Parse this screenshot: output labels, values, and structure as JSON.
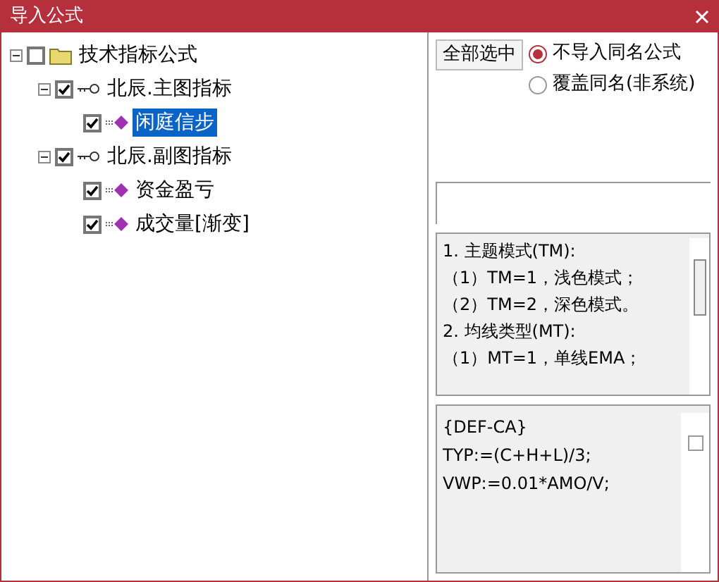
{
  "window": {
    "title": "导入公式"
  },
  "tree": [
    {
      "label": "技术指标公式",
      "kind": "folder",
      "checked": false,
      "expanded": true,
      "selected": false,
      "children": [
        {
          "label": "北辰.主图指标",
          "kind": "group",
          "checked": true,
          "expanded": true,
          "selected": false,
          "children": [
            {
              "label": "闲庭信步",
              "kind": "formula",
              "checked": true,
              "selected": true
            }
          ]
        },
        {
          "label": "北辰.副图指标",
          "kind": "group",
          "checked": true,
          "expanded": true,
          "selected": false,
          "children": [
            {
              "label": "资金盈亏",
              "kind": "formula",
              "checked": true,
              "selected": false
            },
            {
              "label": "成交量[渐变]",
              "kind": "formula",
              "checked": true,
              "selected": false
            }
          ]
        }
      ]
    }
  ],
  "select_all_button": "全部选中",
  "options": [
    {
      "label": "不导入同名公式",
      "selected": true
    },
    {
      "label": "覆盖同名(非系统)",
      "selected": false
    }
  ],
  "description": [
    "1. 主题模式(TM):",
    "（1）TM=1，浅色模式；",
    "（2）TM=2，深色模式。",
    "2. 均线类型(MT):",
    "（1）MT=1，单线EMA；"
  ],
  "code": {
    "lines": [
      "{DEF-CA}",
      "TYP:=(C+H+L)/3;",
      "VWP:=0.01*AMO/V;"
    ],
    "checked": false
  }
}
